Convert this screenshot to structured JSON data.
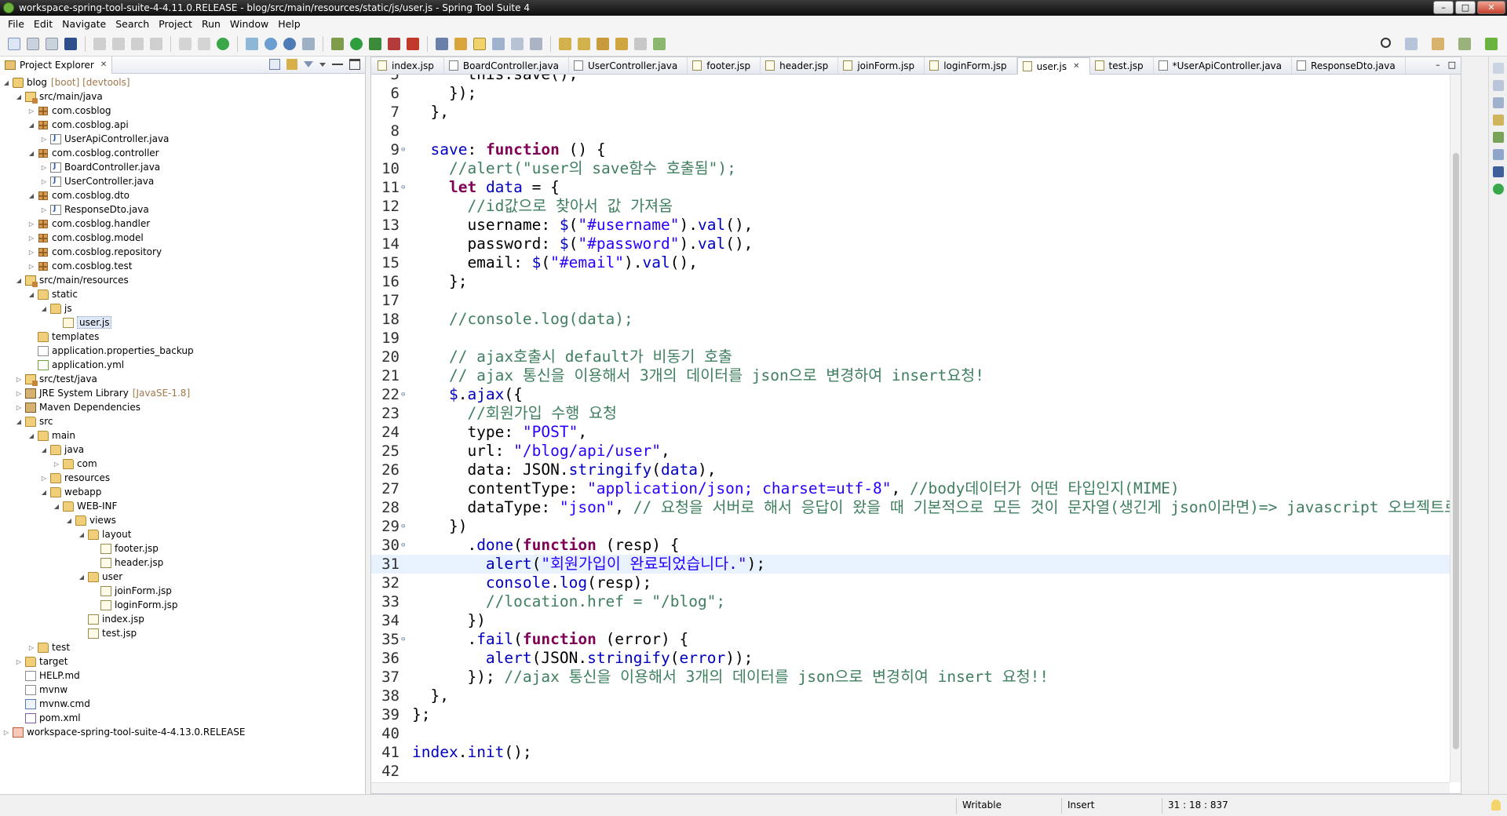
{
  "window": {
    "title": "workspace-spring-tool-suite-4-4.11.0.RELEASE - blog/src/main/resources/static/js/user.js - Spring Tool Suite 4",
    "min": "–",
    "max": "□",
    "close": "✕"
  },
  "menu": [
    "File",
    "Edit",
    "Navigate",
    "Search",
    "Project",
    "Run",
    "Window",
    "Help"
  ],
  "project_explorer": {
    "tab_label": "Project Explorer",
    "tab_close": "✕",
    "tree": [
      {
        "indent": 0,
        "twisty": "◢",
        "icon": "project",
        "label": "blog",
        "decor": "[boot] [devtools]"
      },
      {
        "indent": 1,
        "twisty": "◢",
        "icon": "srcfolder",
        "label": "src/main/java"
      },
      {
        "indent": 2,
        "twisty": "▷",
        "icon": "package",
        "label": "com.cosblog"
      },
      {
        "indent": 2,
        "twisty": "◢",
        "icon": "package",
        "label": "com.cosblog.api"
      },
      {
        "indent": 3,
        "twisty": "▷",
        "icon": "java",
        "label": "UserApiController.java"
      },
      {
        "indent": 2,
        "twisty": "◢",
        "icon": "package",
        "label": "com.cosblog.controller"
      },
      {
        "indent": 3,
        "twisty": "▷",
        "icon": "java",
        "label": "BoardController.java"
      },
      {
        "indent": 3,
        "twisty": "▷",
        "icon": "java",
        "label": "UserController.java"
      },
      {
        "indent": 2,
        "twisty": "◢",
        "icon": "package",
        "label": "com.cosblog.dto"
      },
      {
        "indent": 3,
        "twisty": "▷",
        "icon": "java",
        "label": "ResponseDto.java"
      },
      {
        "indent": 2,
        "twisty": "▷",
        "icon": "package",
        "label": "com.cosblog.handler"
      },
      {
        "indent": 2,
        "twisty": "▷",
        "icon": "package",
        "label": "com.cosblog.model"
      },
      {
        "indent": 2,
        "twisty": "▷",
        "icon": "package",
        "label": "com.cosblog.repository"
      },
      {
        "indent": 2,
        "twisty": "▷",
        "icon": "package",
        "label": "com.cosblog.test"
      },
      {
        "indent": 1,
        "twisty": "◢",
        "icon": "srcfolder",
        "label": "src/main/resources"
      },
      {
        "indent": 2,
        "twisty": "◢",
        "icon": "folder",
        "label": "static"
      },
      {
        "indent": 3,
        "twisty": "◢",
        "icon": "folder",
        "label": "js"
      },
      {
        "indent": 4,
        "twisty": "",
        "icon": "js",
        "label": "user.js",
        "selected": true
      },
      {
        "indent": 2,
        "twisty": "",
        "icon": "folder",
        "label": "templates"
      },
      {
        "indent": 2,
        "twisty": "",
        "icon": "file",
        "label": "application.properties_backup"
      },
      {
        "indent": 2,
        "twisty": "",
        "icon": "yml",
        "label": "application.yml"
      },
      {
        "indent": 1,
        "twisty": "▷",
        "icon": "srcfolder",
        "label": "src/test/java"
      },
      {
        "indent": 1,
        "twisty": "▷",
        "icon": "lib",
        "label": "JRE System Library",
        "decor": "[JavaSE-1.8]"
      },
      {
        "indent": 1,
        "twisty": "▷",
        "icon": "lib",
        "label": "Maven Dependencies"
      },
      {
        "indent": 1,
        "twisty": "◢",
        "icon": "folder",
        "label": "src"
      },
      {
        "indent": 2,
        "twisty": "◢",
        "icon": "folder",
        "label": "main"
      },
      {
        "indent": 3,
        "twisty": "◢",
        "icon": "folder",
        "label": "java"
      },
      {
        "indent": 4,
        "twisty": "▷",
        "icon": "folder",
        "label": "com"
      },
      {
        "indent": 3,
        "twisty": "▷",
        "icon": "folder",
        "label": "resources"
      },
      {
        "indent": 3,
        "twisty": "◢",
        "icon": "folder",
        "label": "webapp"
      },
      {
        "indent": 4,
        "twisty": "◢",
        "icon": "folder",
        "label": "WEB-INF"
      },
      {
        "indent": 5,
        "twisty": "◢",
        "icon": "folder",
        "label": "views"
      },
      {
        "indent": 6,
        "twisty": "◢",
        "icon": "folder",
        "label": "layout"
      },
      {
        "indent": 7,
        "twisty": "",
        "icon": "jsp",
        "label": "footer.jsp"
      },
      {
        "indent": 7,
        "twisty": "",
        "icon": "jsp",
        "label": "header.jsp"
      },
      {
        "indent": 6,
        "twisty": "◢",
        "icon": "folder",
        "label": "user"
      },
      {
        "indent": 7,
        "twisty": "",
        "icon": "jsp",
        "label": "joinForm.jsp"
      },
      {
        "indent": 7,
        "twisty": "",
        "icon": "jsp",
        "label": "loginForm.jsp"
      },
      {
        "indent": 6,
        "twisty": "",
        "icon": "jsp",
        "label": "index.jsp"
      },
      {
        "indent": 6,
        "twisty": "",
        "icon": "jsp",
        "label": "test.jsp"
      },
      {
        "indent": 2,
        "twisty": "▷",
        "icon": "folder",
        "label": "test"
      },
      {
        "indent": 1,
        "twisty": "▷",
        "icon": "folder",
        "label": "target"
      },
      {
        "indent": 1,
        "twisty": "",
        "icon": "file",
        "label": "HELP.md"
      },
      {
        "indent": 1,
        "twisty": "",
        "icon": "file",
        "label": "mvnw"
      },
      {
        "indent": 1,
        "twisty": "",
        "icon": "cmd",
        "label": "mvnw.cmd"
      },
      {
        "indent": 1,
        "twisty": "",
        "icon": "xml",
        "label": "pom.xml"
      },
      {
        "indent": 0,
        "twisty": "▷",
        "icon": "ws",
        "label": "workspace-spring-tool-suite-4-4.13.0.RELEASE"
      }
    ]
  },
  "editor": {
    "tabs": [
      {
        "label": "index.jsp",
        "kind": "jsp"
      },
      {
        "label": "BoardController.java",
        "kind": "java"
      },
      {
        "label": "UserController.java",
        "kind": "java"
      },
      {
        "label": "footer.jsp",
        "kind": "jsp"
      },
      {
        "label": "header.jsp",
        "kind": "jsp"
      },
      {
        "label": "joinForm.jsp",
        "kind": "jsp"
      },
      {
        "label": "loginForm.jsp",
        "kind": "jsp"
      },
      {
        "label": "user.js",
        "kind": "js",
        "active": true,
        "close": "✕"
      },
      {
        "label": "test.jsp",
        "kind": "jsp"
      },
      {
        "label": "*UserApiController.java",
        "kind": "java"
      },
      {
        "label": "ResponseDto.java",
        "kind": "java"
      }
    ],
    "min": "–",
    "max": "□",
    "current_line": 31,
    "lines": [
      {
        "n": "5",
        "fold": "",
        "tokens": [
          [
            "fn",
            "      this.save();"
          ]
        ]
      },
      {
        "n": "6",
        "fold": "",
        "tokens": [
          [
            "fn",
            "    });"
          ]
        ]
      },
      {
        "n": "7",
        "fold": "",
        "tokens": [
          [
            "fn",
            "  },"
          ]
        ]
      },
      {
        "n": "8",
        "fold": "",
        "tokens": [
          [
            "fn",
            ""
          ]
        ]
      },
      {
        "n": "9",
        "fold": "⊖",
        "tokens": [
          [
            "prop",
            "  save"
          ],
          [
            "fn",
            ": "
          ],
          [
            "kw",
            "function"
          ],
          [
            "fn",
            " () {"
          ]
        ]
      },
      {
        "n": "10",
        "fold": "",
        "tokens": [
          [
            "cm",
            "    //alert(\"user의 save함수 호출됨\");"
          ]
        ]
      },
      {
        "n": "11",
        "fold": "⊖",
        "tokens": [
          [
            "kw",
            "    let"
          ],
          [
            "fn",
            " "
          ],
          [
            "prop",
            "data"
          ],
          [
            "fn",
            " = {"
          ]
        ]
      },
      {
        "n": "12",
        "fold": "",
        "tokens": [
          [
            "cm",
            "      //id값으로 찾아서 값 가져옴"
          ]
        ]
      },
      {
        "n": "13",
        "fold": "",
        "tokens": [
          [
            "fn",
            "      username: "
          ],
          [
            "prop",
            "$"
          ],
          [
            "fn",
            "("
          ],
          [
            "str",
            "\"#username\""
          ],
          [
            "fn",
            ")."
          ],
          [
            "prop",
            "val"
          ],
          [
            "fn",
            "(),"
          ]
        ]
      },
      {
        "n": "14",
        "fold": "",
        "tokens": [
          [
            "fn",
            "      password: "
          ],
          [
            "prop",
            "$"
          ],
          [
            "fn",
            "("
          ],
          [
            "str",
            "\"#password\""
          ],
          [
            "fn",
            ")."
          ],
          [
            "prop",
            "val"
          ],
          [
            "fn",
            "(),"
          ]
        ]
      },
      {
        "n": "15",
        "fold": "",
        "tokens": [
          [
            "fn",
            "      email: "
          ],
          [
            "prop",
            "$"
          ],
          [
            "fn",
            "("
          ],
          [
            "str",
            "\"#email\""
          ],
          [
            "fn",
            ")."
          ],
          [
            "prop",
            "val"
          ],
          [
            "fn",
            "(),"
          ]
        ]
      },
      {
        "n": "16",
        "fold": "",
        "tokens": [
          [
            "fn",
            "    };"
          ]
        ]
      },
      {
        "n": "17",
        "fold": "",
        "tokens": [
          [
            "fn",
            ""
          ]
        ]
      },
      {
        "n": "18",
        "fold": "",
        "tokens": [
          [
            "cm",
            "    //console.log(data);"
          ]
        ]
      },
      {
        "n": "19",
        "fold": "",
        "tokens": [
          [
            "fn",
            ""
          ]
        ]
      },
      {
        "n": "20",
        "fold": "",
        "tokens": [
          [
            "cm",
            "    // ajax호출시 default가 비동기 호출"
          ]
        ]
      },
      {
        "n": "21",
        "fold": "",
        "tokens": [
          [
            "cm",
            "    // ajax 통신을 이용해서 3개의 데이터를 json으로 변경하여 insert요청!"
          ]
        ]
      },
      {
        "n": "22",
        "fold": "⊖",
        "tokens": [
          [
            "prop",
            "    $"
          ],
          [
            "fn",
            "."
          ],
          [
            "prop",
            "ajax"
          ],
          [
            "fn",
            "({"
          ]
        ]
      },
      {
        "n": "23",
        "fold": "",
        "tokens": [
          [
            "cm",
            "      //회원가입 수행 요청"
          ]
        ]
      },
      {
        "n": "24",
        "fold": "",
        "tokens": [
          [
            "fn",
            "      type: "
          ],
          [
            "str",
            "\"POST\""
          ],
          [
            "fn",
            ","
          ]
        ]
      },
      {
        "n": "25",
        "fold": "",
        "tokens": [
          [
            "fn",
            "      url: "
          ],
          [
            "str",
            "\"/blog/api/user\""
          ],
          [
            "fn",
            ","
          ]
        ]
      },
      {
        "n": "26",
        "fold": "",
        "tokens": [
          [
            "fn",
            "      data: JSON."
          ],
          [
            "prop",
            "stringify"
          ],
          [
            "fn",
            "("
          ],
          [
            "prop",
            "data"
          ],
          [
            "fn",
            "),"
          ]
        ]
      },
      {
        "n": "27",
        "fold": "",
        "tokens": [
          [
            "fn",
            "      contentType: "
          ],
          [
            "str",
            "\"application/json; charset=utf-8\""
          ],
          [
            "fn",
            ", "
          ],
          [
            "cm",
            "//body데이터가 어떤 타입인지(MIME)"
          ]
        ]
      },
      {
        "n": "28",
        "fold": "",
        "tokens": [
          [
            "fn",
            "      dataType: "
          ],
          [
            "str",
            "\"json\""
          ],
          [
            "fn",
            ", "
          ],
          [
            "cm",
            "// 요청을 서버로 해서 응답이 왔을 때 기본적으로 모든 것이 문자열(생긴게 json이라면)=> javascript 오브젝트로 변경"
          ]
        ]
      },
      {
        "n": "29",
        "fold": "⊖",
        "tokens": [
          [
            "fn",
            "    })"
          ]
        ]
      },
      {
        "n": "30",
        "fold": "⊖",
        "tokens": [
          [
            "fn",
            "      ."
          ],
          [
            "prop",
            "done"
          ],
          [
            "fn",
            "("
          ],
          [
            "kw",
            "function"
          ],
          [
            "fn",
            " (resp) {"
          ]
        ]
      },
      {
        "n": "31",
        "fold": "",
        "tokens": [
          [
            "prop",
            "        alert"
          ],
          [
            "fn",
            "("
          ],
          [
            "str",
            "\"회원가입이 완료되었습니다.\""
          ],
          [
            "fn",
            ");"
          ]
        ]
      },
      {
        "n": "32",
        "fold": "",
        "tokens": [
          [
            "prop",
            "        console"
          ],
          [
            "fn",
            "."
          ],
          [
            "prop",
            "log"
          ],
          [
            "fn",
            "(resp);"
          ]
        ]
      },
      {
        "n": "33",
        "fold": "",
        "tokens": [
          [
            "cm",
            "        //location.href = \"/blog\";"
          ]
        ]
      },
      {
        "n": "34",
        "fold": "",
        "tokens": [
          [
            "fn",
            "      })"
          ]
        ]
      },
      {
        "n": "35",
        "fold": "⊖",
        "tokens": [
          [
            "fn",
            "      ."
          ],
          [
            "prop",
            "fail"
          ],
          [
            "fn",
            "("
          ],
          [
            "kw",
            "function"
          ],
          [
            "fn",
            " (error) {"
          ]
        ]
      },
      {
        "n": "36",
        "fold": "",
        "tokens": [
          [
            "prop",
            "        alert"
          ],
          [
            "fn",
            "(JSON."
          ],
          [
            "prop",
            "stringify"
          ],
          [
            "fn",
            "("
          ],
          [
            "prop",
            "error"
          ],
          [
            "fn",
            "));"
          ]
        ]
      },
      {
        "n": "37",
        "fold": "",
        "tokens": [
          [
            "fn",
            "      }); "
          ],
          [
            "cm",
            "//ajax 통신을 이용해서 3개의 데이터를 json으로 변경히여 insert 요청!!"
          ]
        ]
      },
      {
        "n": "38",
        "fold": "",
        "tokens": [
          [
            "fn",
            "  },"
          ]
        ]
      },
      {
        "n": "39",
        "fold": "",
        "tokens": [
          [
            "fn",
            "};"
          ]
        ]
      },
      {
        "n": "40",
        "fold": "",
        "tokens": [
          [
            "fn",
            ""
          ]
        ]
      },
      {
        "n": "41",
        "fold": "",
        "tokens": [
          [
            "prop",
            "index"
          ],
          [
            "fn",
            "."
          ],
          [
            "prop",
            "init"
          ],
          [
            "fn",
            "();"
          ]
        ]
      },
      {
        "n": "42",
        "fold": "",
        "tokens": [
          [
            "fn",
            ""
          ]
        ]
      }
    ]
  },
  "status": {
    "writable": "Writable",
    "insert": "Insert",
    "position": "31 : 18 : 837"
  },
  "colors": {
    "keyword": "#7f0055",
    "string": "#2a00ff",
    "comment": "#3f7f5f",
    "identifier": "#0000c0",
    "current_line": "#e8f2fe"
  }
}
